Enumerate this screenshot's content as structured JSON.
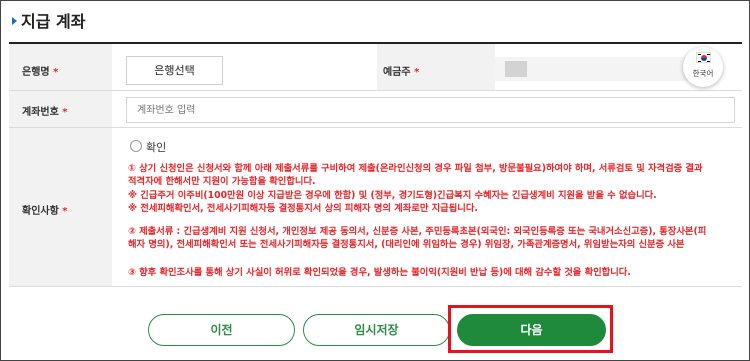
{
  "section": {
    "title": "지급 계좌"
  },
  "bank": {
    "label": "은행명",
    "required_mark": "*",
    "select_button": "은행선택"
  },
  "holder": {
    "label": "예금주",
    "required_mark": "*"
  },
  "account": {
    "label": "계좌번호",
    "required_mark": "*",
    "placeholder": "계좌번호 입력"
  },
  "confirm": {
    "label": "확인사항",
    "required_mark": "*",
    "checkbox_label": "확인",
    "notices": [
      "① 상기 신청인은 신청서와 함께 아래 제출서류를 구비하여 제출(온라인신청의 경우 파일 첨부, 방문불필요)하여야 하며, 서류검토 및 자격검증 결과",
      "적격자에 한해서만 지원이 가능함을 확인합니다.",
      "※ 긴급주거 이주비(100만원 이상 지급받은 경우에 한함) 및 (정부, 경기도형)긴급복지 수혜자는 긴급생계비 지원을 받을 수 없습니다.",
      "※ 전세피해확인서, 전세사기피해자등 결정통지서 상의 피해자 명의 계좌로만 지급됩니다.",
      "② 제출서류 : 긴급생계비 지원 신청서, 개인정보 제공 동의서, 신분증 사본, 주민등록초본(외국인: 외국인등록증 또는 국내거소신고증), 통장사본(피",
      "해자 명의), 전세피해확인서 또는 전세사기피해자등 결정통지서, (대리인에 위임하는 경우) 위임장, 가족관계증명서, 위임받는자의 신분증 사본",
      "③ 향후 확인조사를 통해 상기 사실이 허위로 확인되었을 경우, 발생하는 불이익(지원비 반납 등)에 대해 감수할 것을 확인합니다."
    ]
  },
  "language": {
    "label": "한국어",
    "icon": "korea-flag-icon"
  },
  "buttons": {
    "prev": "이전",
    "temp_save": "임시저장",
    "next": "다음"
  },
  "colors": {
    "accent_green": "#1f8a3c",
    "notice_red": "#e5282c",
    "highlight_red": "#e5141c",
    "title_marker": "#1a6fb5"
  }
}
